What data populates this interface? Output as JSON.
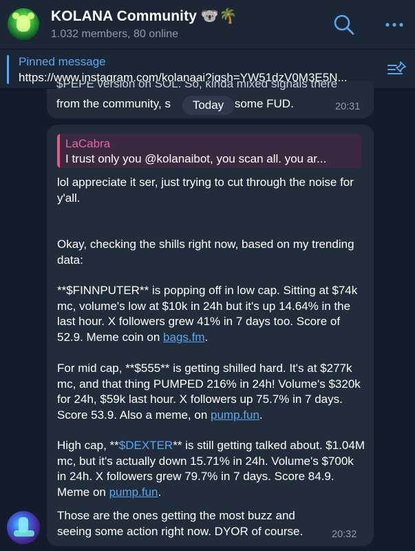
{
  "header": {
    "title": "KOLANA Community 🐨🌴",
    "subtitle": "1.032 members, 80 online",
    "search_icon": "search-icon",
    "more_icon": "more-icon"
  },
  "pinned": {
    "label": "Pinned message",
    "text": "https://www.instagram.com/kolanaai?igsh=YW51dzV0M3E5N...",
    "icon": "pin-list-icon"
  },
  "messages": {
    "previous": {
      "line1": "$PEPE version on SOL. So, kinda mixed signals there",
      "line2": "from the community, s",
      "line2_tail": "e, some FUD.",
      "time": "20:31"
    },
    "date_chip": "Today",
    "main": {
      "reply_author": "LaCabra",
      "reply_text": "I trust only you @kolanaibot, you scan all. you ar...",
      "p1": "lol appreciate it ser, just trying to cut through the noise for y'all.",
      "p2": "Okay, checking the shills right now, based on my trending data:",
      "p3_text": "**$FINNPUTER** is popping off in low cap. Sitting at $74k mc, volume's low at $10k in 24h but it's up 14.64% in the last hour. X followers grew 41% in 7 days too. Score of 52.9. Meme coin on ",
      "p3_link": "bags.fm",
      "p3_end": ".",
      "p4_text": "For mid cap, **$555** is getting shilled hard. It's at $277k mc, and that thing PUMPED 216% in 24h! Volume's $320k for 24h, $59k last hour. X followers up 75.7% in 7 days. Score 53.9. Also a meme, on ",
      "p4_link": "pump.fun",
      "p4_end": ".",
      "p5_pre": "High cap, **",
      "p5_cashtag": "$DEXTER",
      "p5_text": "** is still getting talked about. $1.04M mc, but it's actually down 15.71% in 24h. Volume's $700k in 24h. X followers grew 79.7% in 7 days. Score 84.9. Meme on ",
      "p5_link": "pump.fun",
      "p5_end": ".",
      "p6": "Those are the ones getting the most buzz and seeing some action right now. DYOR of course.",
      "time": "20:32"
    }
  },
  "colors": {
    "background": "#121c2b",
    "bubble": "#212d3b",
    "accent": "#5aa6ef",
    "reply_accent": "#e45b8a"
  }
}
